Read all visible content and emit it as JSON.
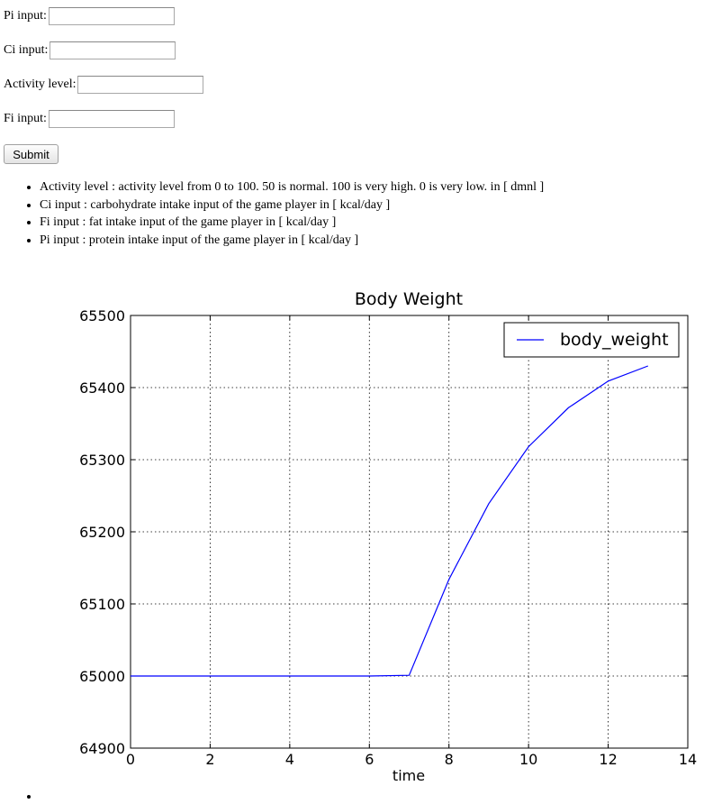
{
  "form": {
    "pi_label": "Pi input:",
    "ci_label": "Ci input:",
    "activity_label": "Activity level:",
    "fi_label": "Fi input:",
    "pi_value": "",
    "ci_value": "",
    "activity_value": "",
    "fi_value": "",
    "submit_label": "Submit"
  },
  "descriptions": [
    "Activity level : activity level from 0 to 100. 50 is normal. 100 is very high. 0 is very low. in [ dmnl ]",
    "Ci input : carbohydrate intake input of the game player in [ kcal/day ]",
    "Fi input : fat intake input of the game player in [ kcal/day ]",
    "Pi input : protein intake input of the game player in [ kcal/day ]"
  ],
  "colors": {
    "line": "#0000ff"
  },
  "chart_data": {
    "type": "line",
    "title": "Body Weight",
    "xlabel": "time",
    "ylabel": "",
    "xlim": [
      0,
      14
    ],
    "ylim": [
      64900,
      65500
    ],
    "xticks": [
      "0",
      "2",
      "4",
      "6",
      "8",
      "10",
      "12",
      "14"
    ],
    "yticks": [
      "64900",
      "65000",
      "65100",
      "65200",
      "65300",
      "65400",
      "65500"
    ],
    "grid": true,
    "legend_position": "top-right",
    "series": [
      {
        "name": "body_weight",
        "x": [
          0,
          1,
          2,
          3,
          4,
          5,
          6,
          7,
          8,
          9,
          10,
          11,
          12,
          13
        ],
        "y": [
          65000,
          65000,
          65000,
          65000,
          65000,
          65000,
          65000,
          65001,
          65134,
          65239,
          65318,
          65372,
          65409,
          65430
        ]
      }
    ]
  }
}
